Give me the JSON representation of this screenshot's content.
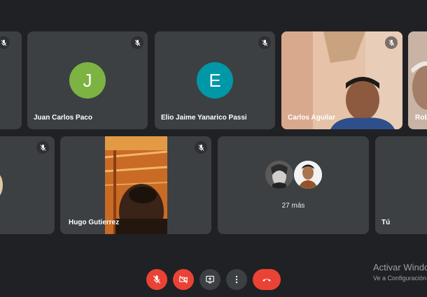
{
  "participants": {
    "juan": {
      "initial": "J",
      "name": "Juan Carlos Paco",
      "avatar_color": "#7cb342"
    },
    "elio": {
      "initial": "E",
      "name": "Elio Jaime Yanarico Passi",
      "avatar_color": "#0097a7"
    },
    "carlos": {
      "name": "Carlos Aguilar"
    },
    "rob": {
      "name": "Rob"
    },
    "hugo": {
      "name": "Hugo Gutierrez"
    },
    "more": {
      "label": "27 más"
    },
    "self": {
      "name": "Tú"
    }
  },
  "watermark": {
    "line1": "Activar Windows",
    "line2": "Ve a Configuración"
  },
  "colors": {
    "background": "#202124",
    "tile": "#3c4043",
    "end_call": "#ea4335",
    "muted_control": "#ea4335"
  },
  "icons": {
    "mic_off": "mic-off-icon",
    "cam_off": "camera-off-icon",
    "present": "present-screen-icon",
    "more": "more-vert-icon",
    "hangup": "hang-up-icon"
  }
}
